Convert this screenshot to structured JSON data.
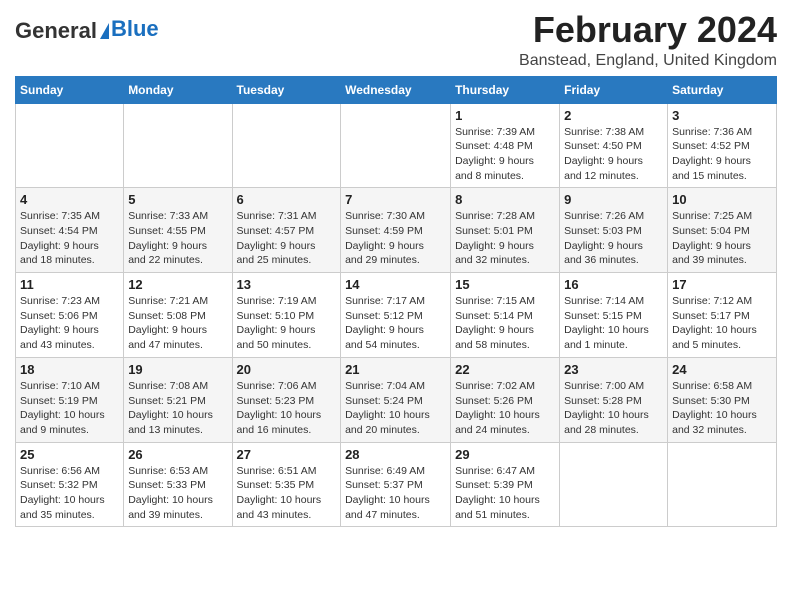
{
  "header": {
    "logo_line1": "General",
    "logo_line2": "Blue",
    "main_title": "February 2024",
    "subtitle": "Banstead, England, United Kingdom"
  },
  "calendar": {
    "columns": [
      "Sunday",
      "Monday",
      "Tuesday",
      "Wednesday",
      "Thursday",
      "Friday",
      "Saturday"
    ],
    "weeks": [
      [
        {
          "day": "",
          "info": ""
        },
        {
          "day": "",
          "info": ""
        },
        {
          "day": "",
          "info": ""
        },
        {
          "day": "",
          "info": ""
        },
        {
          "day": "1",
          "info": "Sunrise: 7:39 AM\nSunset: 4:48 PM\nDaylight: 9 hours\nand 8 minutes."
        },
        {
          "day": "2",
          "info": "Sunrise: 7:38 AM\nSunset: 4:50 PM\nDaylight: 9 hours\nand 12 minutes."
        },
        {
          "day": "3",
          "info": "Sunrise: 7:36 AM\nSunset: 4:52 PM\nDaylight: 9 hours\nand 15 minutes."
        }
      ],
      [
        {
          "day": "4",
          "info": "Sunrise: 7:35 AM\nSunset: 4:54 PM\nDaylight: 9 hours\nand 18 minutes."
        },
        {
          "day": "5",
          "info": "Sunrise: 7:33 AM\nSunset: 4:55 PM\nDaylight: 9 hours\nand 22 minutes."
        },
        {
          "day": "6",
          "info": "Sunrise: 7:31 AM\nSunset: 4:57 PM\nDaylight: 9 hours\nand 25 minutes."
        },
        {
          "day": "7",
          "info": "Sunrise: 7:30 AM\nSunset: 4:59 PM\nDaylight: 9 hours\nand 29 minutes."
        },
        {
          "day": "8",
          "info": "Sunrise: 7:28 AM\nSunset: 5:01 PM\nDaylight: 9 hours\nand 32 minutes."
        },
        {
          "day": "9",
          "info": "Sunrise: 7:26 AM\nSunset: 5:03 PM\nDaylight: 9 hours\nand 36 minutes."
        },
        {
          "day": "10",
          "info": "Sunrise: 7:25 AM\nSunset: 5:04 PM\nDaylight: 9 hours\nand 39 minutes."
        }
      ],
      [
        {
          "day": "11",
          "info": "Sunrise: 7:23 AM\nSunset: 5:06 PM\nDaylight: 9 hours\nand 43 minutes."
        },
        {
          "day": "12",
          "info": "Sunrise: 7:21 AM\nSunset: 5:08 PM\nDaylight: 9 hours\nand 47 minutes."
        },
        {
          "day": "13",
          "info": "Sunrise: 7:19 AM\nSunset: 5:10 PM\nDaylight: 9 hours\nand 50 minutes."
        },
        {
          "day": "14",
          "info": "Sunrise: 7:17 AM\nSunset: 5:12 PM\nDaylight: 9 hours\nand 54 minutes."
        },
        {
          "day": "15",
          "info": "Sunrise: 7:15 AM\nSunset: 5:14 PM\nDaylight: 9 hours\nand 58 minutes."
        },
        {
          "day": "16",
          "info": "Sunrise: 7:14 AM\nSunset: 5:15 PM\nDaylight: 10 hours\nand 1 minute."
        },
        {
          "day": "17",
          "info": "Sunrise: 7:12 AM\nSunset: 5:17 PM\nDaylight: 10 hours\nand 5 minutes."
        }
      ],
      [
        {
          "day": "18",
          "info": "Sunrise: 7:10 AM\nSunset: 5:19 PM\nDaylight: 10 hours\nand 9 minutes."
        },
        {
          "day": "19",
          "info": "Sunrise: 7:08 AM\nSunset: 5:21 PM\nDaylight: 10 hours\nand 13 minutes."
        },
        {
          "day": "20",
          "info": "Sunrise: 7:06 AM\nSunset: 5:23 PM\nDaylight: 10 hours\nand 16 minutes."
        },
        {
          "day": "21",
          "info": "Sunrise: 7:04 AM\nSunset: 5:24 PM\nDaylight: 10 hours\nand 20 minutes."
        },
        {
          "day": "22",
          "info": "Sunrise: 7:02 AM\nSunset: 5:26 PM\nDaylight: 10 hours\nand 24 minutes."
        },
        {
          "day": "23",
          "info": "Sunrise: 7:00 AM\nSunset: 5:28 PM\nDaylight: 10 hours\nand 28 minutes."
        },
        {
          "day": "24",
          "info": "Sunrise: 6:58 AM\nSunset: 5:30 PM\nDaylight: 10 hours\nand 32 minutes."
        }
      ],
      [
        {
          "day": "25",
          "info": "Sunrise: 6:56 AM\nSunset: 5:32 PM\nDaylight: 10 hours\nand 35 minutes."
        },
        {
          "day": "26",
          "info": "Sunrise: 6:53 AM\nSunset: 5:33 PM\nDaylight: 10 hours\nand 39 minutes."
        },
        {
          "day": "27",
          "info": "Sunrise: 6:51 AM\nSunset: 5:35 PM\nDaylight: 10 hours\nand 43 minutes."
        },
        {
          "day": "28",
          "info": "Sunrise: 6:49 AM\nSunset: 5:37 PM\nDaylight: 10 hours\nand 47 minutes."
        },
        {
          "day": "29",
          "info": "Sunrise: 6:47 AM\nSunset: 5:39 PM\nDaylight: 10 hours\nand 51 minutes."
        },
        {
          "day": "",
          "info": ""
        },
        {
          "day": "",
          "info": ""
        }
      ]
    ]
  }
}
